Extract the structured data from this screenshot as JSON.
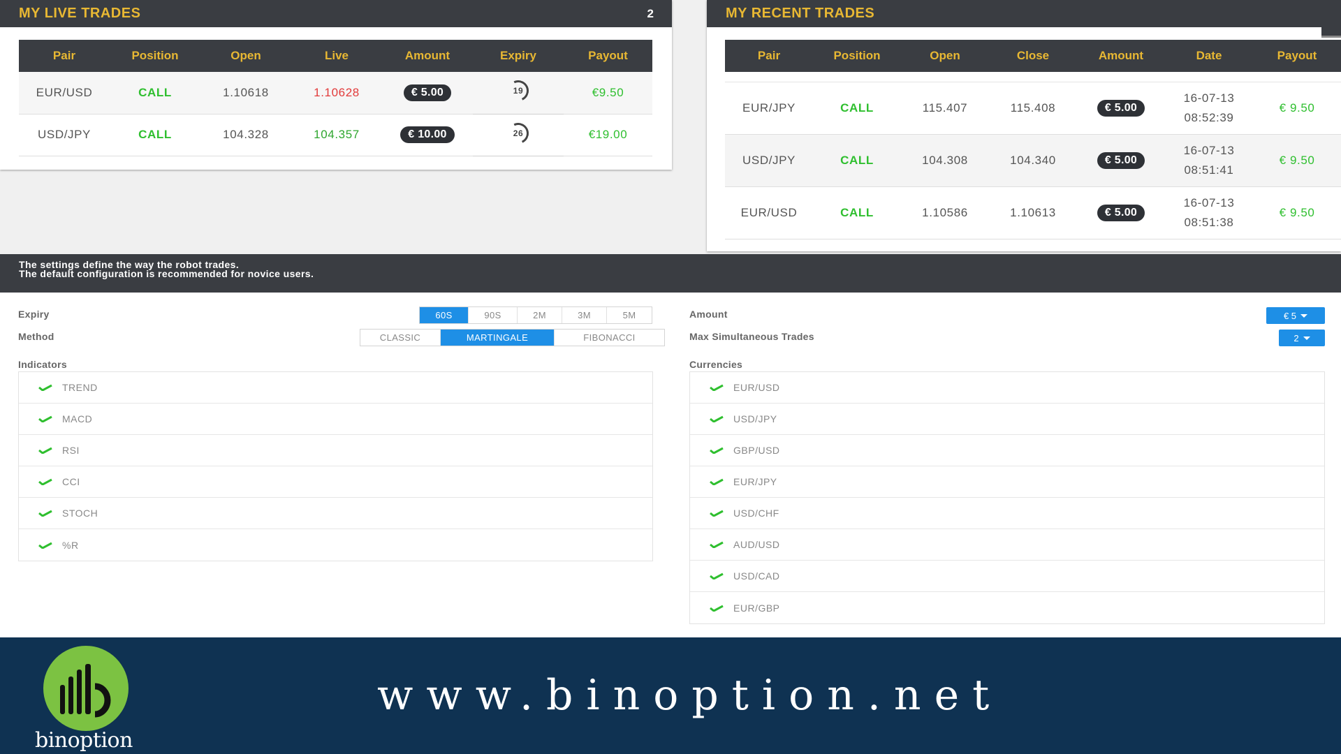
{
  "colors": {
    "panel_header_bg": "#3a3d42",
    "header_text": "#e8b833",
    "call_green": "#2fbf2f",
    "live_red": "#e23b3b",
    "accent_blue": "#1e8fe6",
    "footer_bg": "#0f3252",
    "logo_green": "#7cc242"
  },
  "live_trades": {
    "title": "MY LIVE TRADES",
    "count": "2",
    "columns": [
      "Pair",
      "Position",
      "Open",
      "Live",
      "Amount",
      "Expiry",
      "Payout"
    ],
    "rows": [
      {
        "pair": "EUR/USD",
        "position": "CALL",
        "open": "1.10618",
        "live": "1.10628",
        "live_trend": "down",
        "amount": "€ 5.00",
        "expiry": "19",
        "payout": "€9.50"
      },
      {
        "pair": "USD/JPY",
        "position": "CALL",
        "open": "104.328",
        "live": "104.357",
        "live_trend": "up",
        "amount": "€ 10.00",
        "expiry": "26",
        "payout": "€19.00"
      }
    ]
  },
  "recent_trades": {
    "title": "MY RECENT TRADES",
    "columns": [
      "Pair",
      "Position",
      "Open",
      "Close",
      "Amount",
      "Date",
      "Payout"
    ],
    "rows": [
      {
        "pair": "EUR/JPY",
        "position": "CALL",
        "open": "115.407",
        "close": "115.408",
        "amount": "€ 5.00",
        "date": "16-07-13",
        "time": "08:52:39",
        "payout": "€ 9.50"
      },
      {
        "pair": "USD/JPY",
        "position": "CALL",
        "open": "104.308",
        "close": "104.340",
        "amount": "€ 5.00",
        "date": "16-07-13",
        "time": "08:51:41",
        "payout": "€ 9.50"
      },
      {
        "pair": "EUR/USD",
        "position": "CALL",
        "open": "1.10586",
        "close": "1.10613",
        "amount": "€ 5.00",
        "date": "16-07-13",
        "time": "08:51:38",
        "payout": "€ 9.50"
      }
    ]
  },
  "settings": {
    "description_line1": "The settings define the way the robot trades.",
    "description_line2": "The default configuration is recommended for novice users.",
    "expiry": {
      "label": "Expiry",
      "options": [
        "60S",
        "90S",
        "2M",
        "3M",
        "5M"
      ],
      "selected": "60S"
    },
    "method": {
      "label": "Method",
      "options": [
        "CLASSIC",
        "MARTINGALE",
        "FIBONACCI"
      ],
      "selected": "MARTINGALE"
    },
    "amount": {
      "label": "Amount",
      "value": "€ 5"
    },
    "max_trades": {
      "label": "Max Simultaneous Trades",
      "value": "2"
    },
    "indicators": {
      "label": "Indicators",
      "items": [
        "TREND",
        "MACD",
        "RSI",
        "CCI",
        "STOCH",
        "%R"
      ]
    },
    "currencies": {
      "label": "Currencies",
      "items": [
        "EUR/USD",
        "USD/JPY",
        "GBP/USD",
        "EUR/JPY",
        "USD/CHF",
        "AUD/USD",
        "USD/CAD",
        "EUR/GBP"
      ]
    }
  },
  "footer": {
    "brand": "binoption",
    "url": "www.binoption.net"
  }
}
